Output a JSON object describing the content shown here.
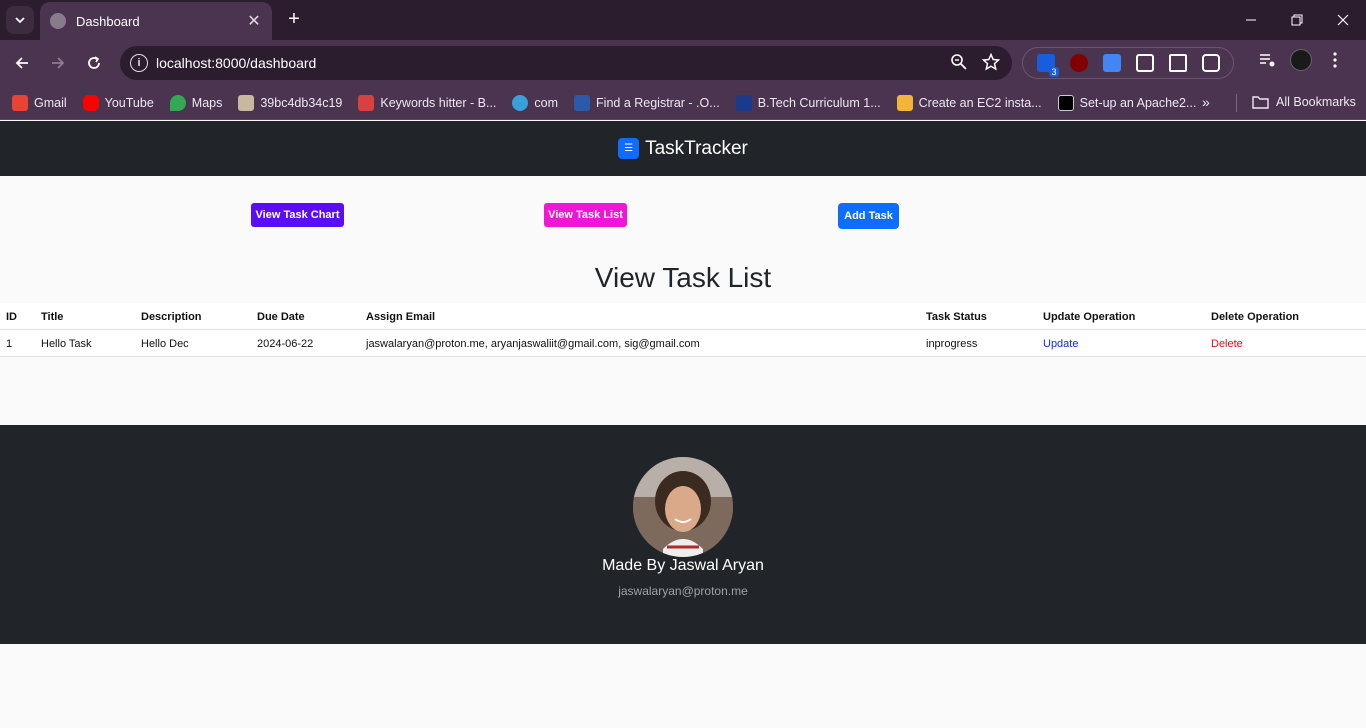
{
  "browser": {
    "tab_title": "Dashboard",
    "tab_close": "✕",
    "new_tab": "+",
    "url": "localhost:8000/dashboard",
    "extension_badge": "3",
    "bookmarks": [
      {
        "label": "Gmail",
        "color": "#ea4335"
      },
      {
        "label": "YouTube",
        "color": "#ff0000"
      },
      {
        "label": "Maps",
        "color": "#34a853"
      },
      {
        "label": "39bc4db34c19",
        "color": "#c9b8a0"
      },
      {
        "label": "Keywords hitter - B...",
        "color": "#d94040"
      },
      {
        "label": "com",
        "color": "#3aa0d8"
      },
      {
        "label": "Find a Registrar - .O...",
        "color": "#2a5aa8"
      },
      {
        "label": "B.Tech Curriculum 1...",
        "color": "#1a3a8a"
      },
      {
        "label": "Create an EC2 insta...",
        "color": "#f2b53a"
      },
      {
        "label": "Set-up an Apache2...",
        "color": "#000000"
      }
    ],
    "all_bookmarks": "All Bookmarks"
  },
  "app": {
    "brand": "TaskTracker",
    "buttons": {
      "chart": "View Task Chart",
      "list": "View Task List",
      "add": "Add Task"
    },
    "heading": "View Task List",
    "table": {
      "headers": [
        "ID",
        "Title",
        "Description",
        "Due Date",
        "Assign Email",
        "Task Status",
        "Update Operation",
        "Delete Operation"
      ],
      "rows": [
        {
          "id": "1",
          "title": "Hello Task",
          "description": "Hello Dec",
          "due_date": "2024-06-22",
          "emails": "jaswalaryan@proton.me, aryanjaswaliit@gmail.com, sig@gmail.com",
          "status": "inprogress",
          "update": "Update",
          "delete": "Delete"
        }
      ]
    },
    "footer": {
      "made_by": "Made By Jaswal Aryan",
      "email": "jaswalaryan@proton.me"
    }
  }
}
